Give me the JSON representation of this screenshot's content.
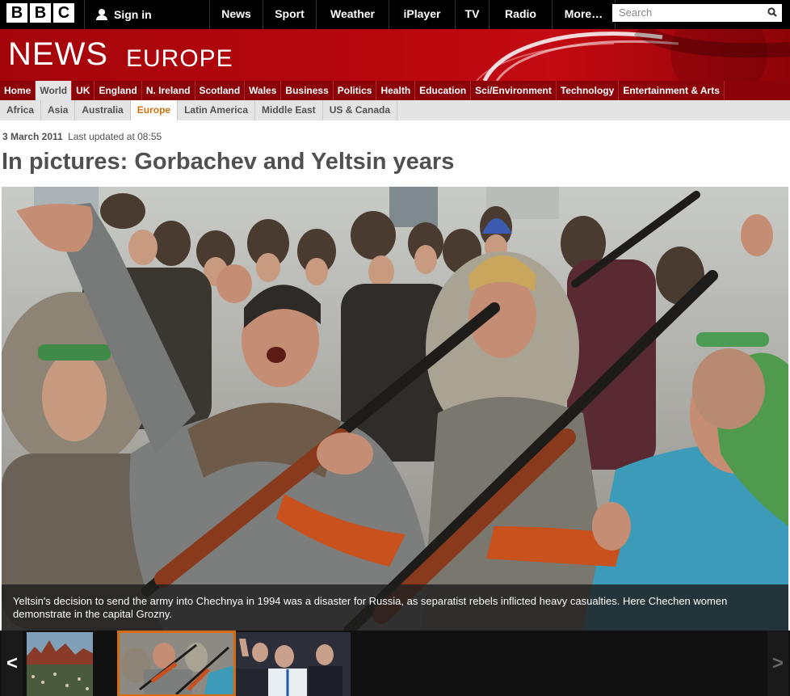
{
  "topbar": {
    "logo_letters": [
      "B",
      "B",
      "C"
    ],
    "signin_label": "Sign in",
    "nav": [
      "News",
      "Sport",
      "Weather",
      "iPlayer",
      "TV",
      "Radio",
      "More…"
    ],
    "search_placeholder": "Search"
  },
  "masthead": {
    "title": "NEWS",
    "section": "EUROPE"
  },
  "main_nav": {
    "items": [
      "Home",
      "World",
      "UK",
      "England",
      "N. Ireland",
      "Scotland",
      "Wales",
      "Business",
      "Politics",
      "Health",
      "Education",
      "Sci/Environment",
      "Technology",
      "Entertainment & Arts"
    ],
    "active": "World"
  },
  "sub_nav": {
    "items": [
      "Africa",
      "Asia",
      "Australia",
      "Europe",
      "Latin America",
      "Middle East",
      "US & Canada"
    ],
    "active": "Europe"
  },
  "article": {
    "date": "3 March 2011",
    "updated": "Last updated at 08:55",
    "headline": "In pictures: Gorbachev and Yeltsin years",
    "caption": "Yeltsin's decision to send the army into Chechnya in 1994 was a disaster for Russia, as separatist rebels inflicted heavy casualties. Here Chechen women demonstrate in the capital Grozny."
  },
  "filmstrip": {
    "prev_arrow": "<",
    "next_arrow": ">",
    "selected_index": 1
  },
  "colors": {
    "bbc_red": "#b5070d",
    "nav_red": "#8b0309",
    "active_orange": "#d1700e",
    "text_grey": "#505050"
  }
}
